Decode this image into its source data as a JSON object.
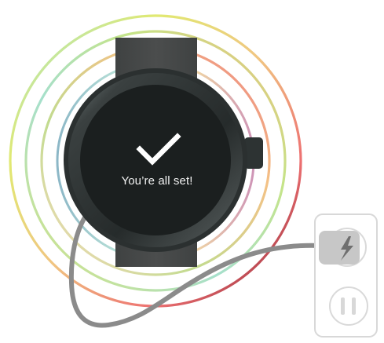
{
  "screen": {
    "message": "You’re all set!"
  },
  "icons": {
    "status": "checkmark-icon",
    "plug": "lightning-bolt-icon",
    "outlet": "power-outlet-icon",
    "watch": "smartwatch-icon"
  },
  "colors": {
    "watch_body": "#2b3030",
    "watch_screen": "#1b1f1f",
    "strap": "#484848",
    "cable": "#8b8b8b",
    "plug": "#c7c7c7",
    "outlet_border": "#d7d7d7",
    "ring_palette": [
      "#9fd8c8",
      "#d6e76d",
      "#f1cf79",
      "#e86a6a",
      "#b05a78",
      "#7eb6c8"
    ]
  }
}
